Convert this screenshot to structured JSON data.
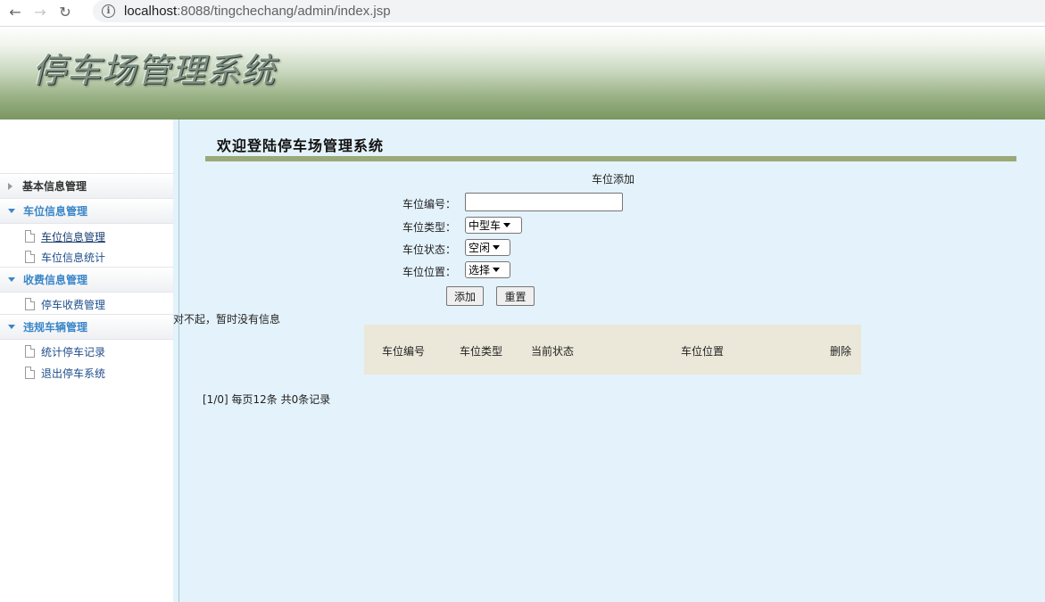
{
  "browser": {
    "url_host": "localhost",
    "url_rest": ":8088/tingchechang/admin/index.jsp"
  },
  "banner": {
    "title": "停车场管理系统"
  },
  "sidebar": {
    "groups": [
      {
        "label": "基本信息管理",
        "expanded": false
      },
      {
        "label": "车位信息管理",
        "expanded": true,
        "items": [
          "车位信息管理",
          "车位信息统计"
        ]
      },
      {
        "label": "收费信息管理",
        "expanded": true,
        "items": [
          "停车收费管理"
        ]
      },
      {
        "label": "违规车辆管理",
        "expanded": true,
        "items": [
          "统计停车记录",
          "退出停车系统"
        ]
      }
    ]
  },
  "main": {
    "welcome": "欢迎登陆停车场管理系统",
    "form": {
      "title": "车位添加",
      "number_label": "车位编号：",
      "number_value": "",
      "type_label": "车位类型：",
      "type_value": "中型车",
      "status_label": "车位状态：",
      "status_value": "空闲",
      "location_label": "车位位置：",
      "location_value": "选择",
      "add_button": "添加",
      "reset_button": "重置"
    },
    "no_info": "对不起，暂时没有信息",
    "table": {
      "headers": [
        "车位编号",
        "车位类型",
        "当前状态",
        "车位位置",
        "删除"
      ]
    },
    "pager": "[1/0] 每页12条 共0条记录"
  },
  "colors": {
    "main_bg": "#e4f2fb",
    "accent_bar": "#9aa97a",
    "menu_blue": "#3a86c8",
    "table_header_bg": "#ebe8d9"
  }
}
